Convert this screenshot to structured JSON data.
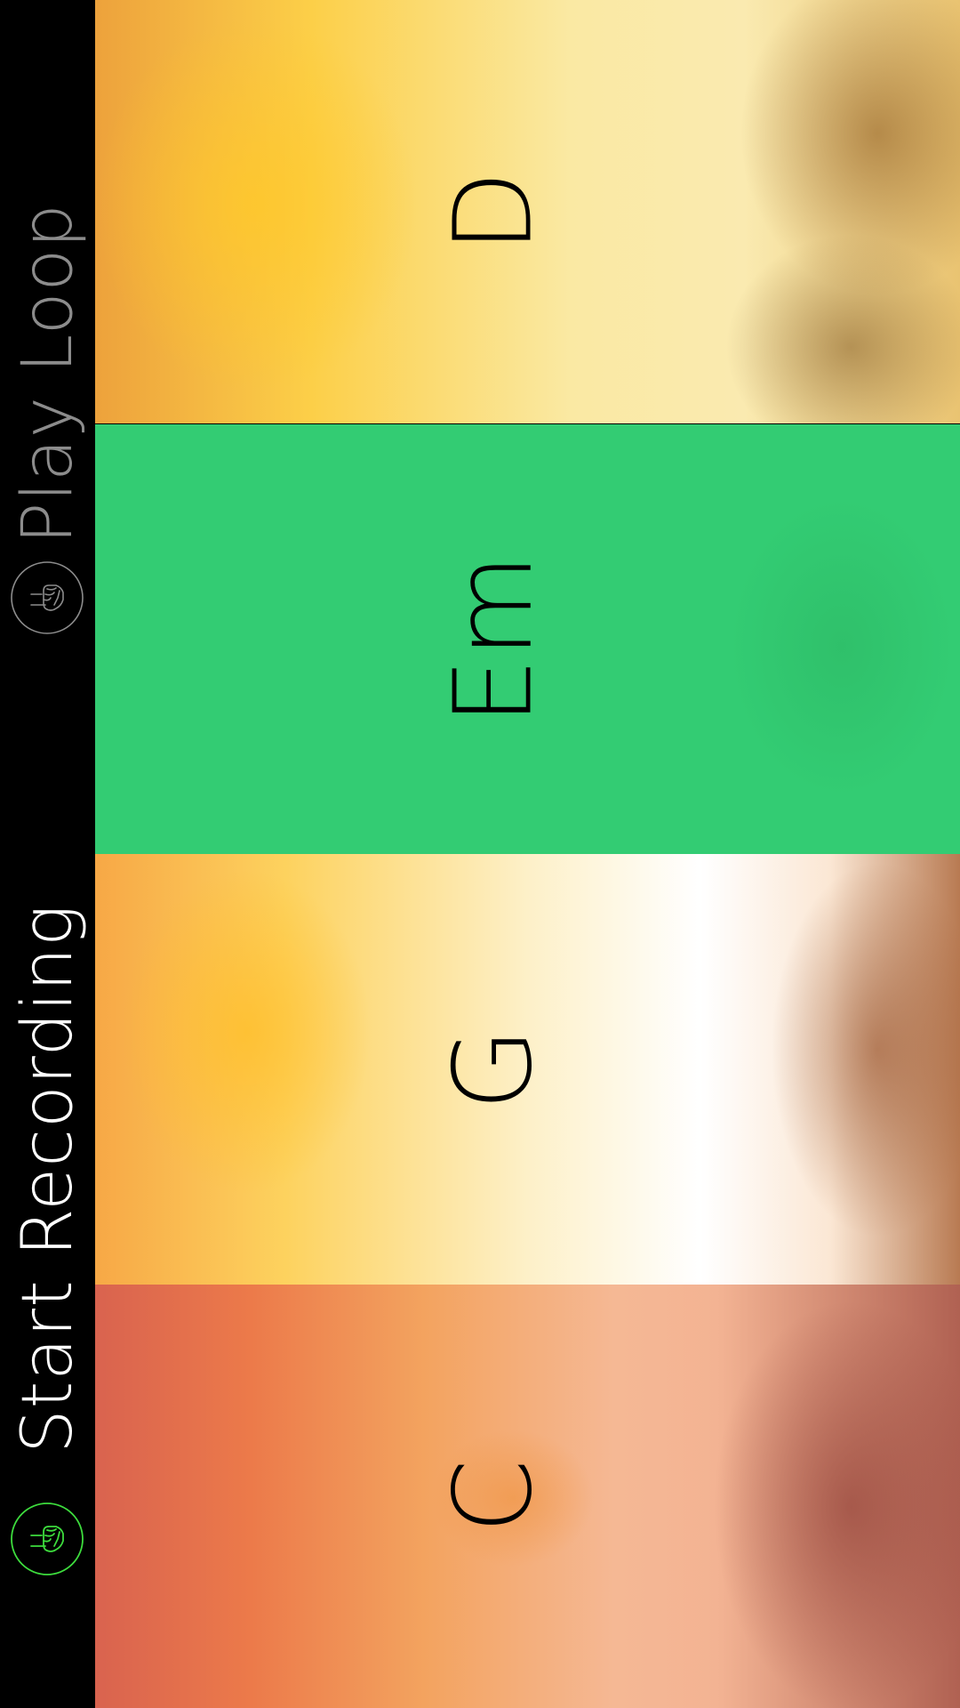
{
  "controls": {
    "play_loop": {
      "label": "Play Loop",
      "icon": "fist-tap-icon",
      "color": "#8c8c8c"
    },
    "start_recording": {
      "label": "Start Recording",
      "icon": "fist-tap-icon",
      "color": "#ffffff",
      "icon_color": "#3ddc3d"
    }
  },
  "chords": [
    {
      "name": "D",
      "selected": false
    },
    {
      "name": "Em",
      "selected": true,
      "color": "#33cc73"
    },
    {
      "name": "G",
      "selected": false
    },
    {
      "name": "C",
      "selected": false
    }
  ]
}
